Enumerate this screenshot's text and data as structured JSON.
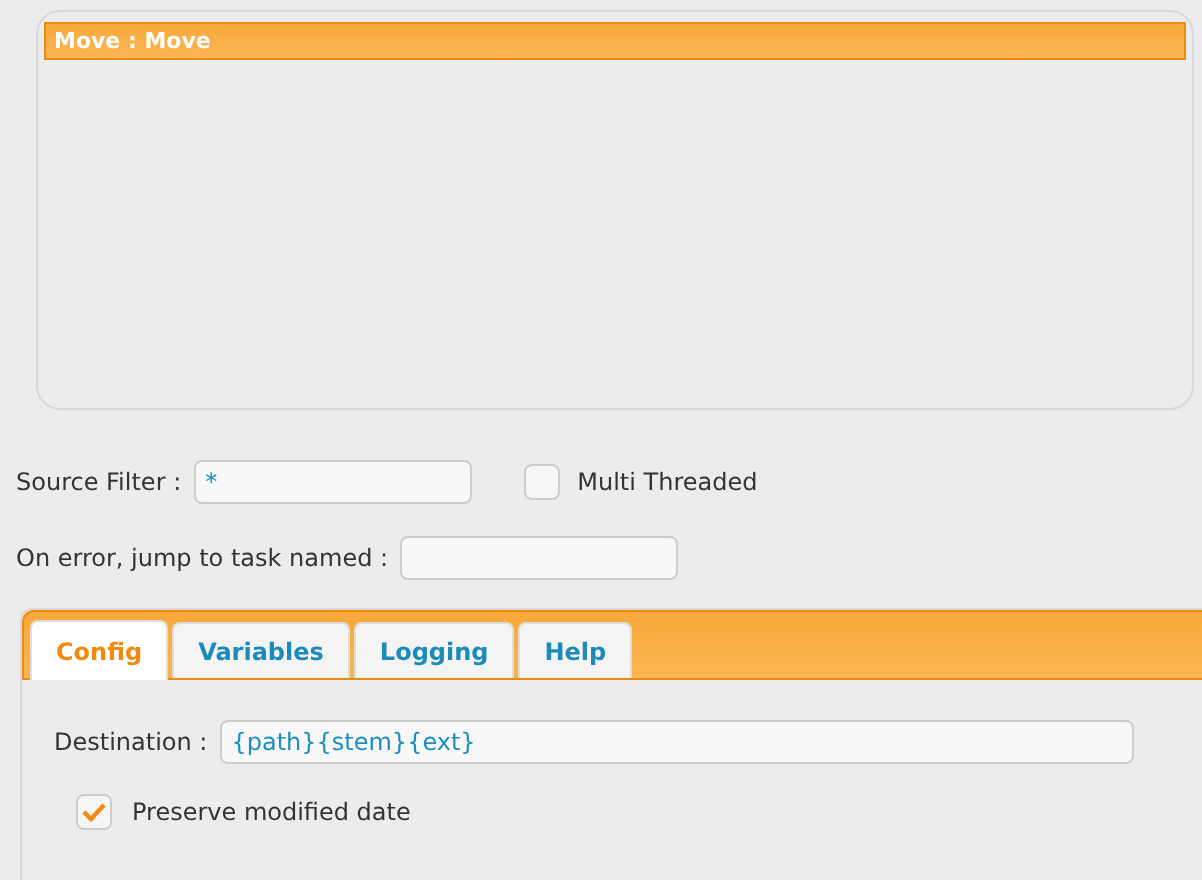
{
  "tasks": [
    {
      "label": "Move : Move",
      "selected": true
    }
  ],
  "source_filter": {
    "label": "Source Filter :",
    "value": "*"
  },
  "multi_threaded": {
    "label": "Multi Threaded",
    "checked": false
  },
  "on_error": {
    "label": "On error, jump to task named :"
  },
  "tabs": [
    {
      "label": "Config",
      "selected": true
    },
    {
      "label": "Variables",
      "selected": false
    },
    {
      "label": "Logging",
      "selected": false
    },
    {
      "label": "Help",
      "selected": false
    }
  ],
  "config": {
    "destination": {
      "label": "Destination :",
      "value": "{path}{stem}{ext}"
    },
    "preserve_modified_date": {
      "label": "Preserve modified date",
      "checked": true
    }
  }
}
